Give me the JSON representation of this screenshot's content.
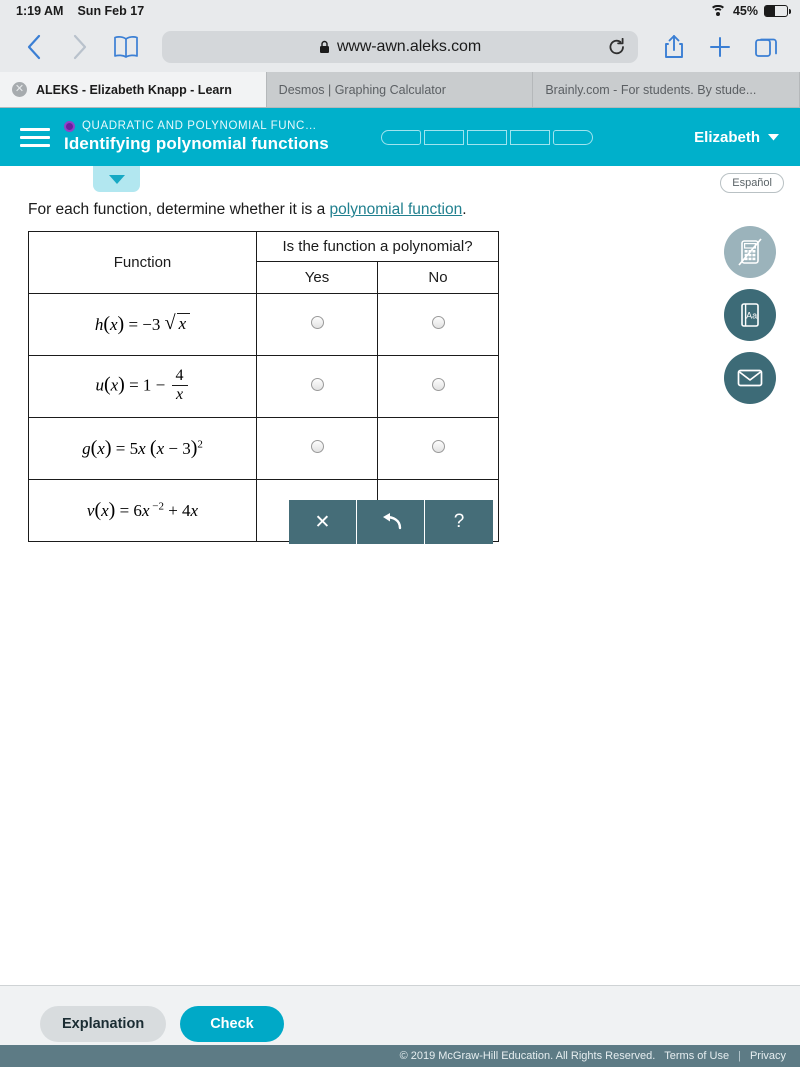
{
  "status_bar": {
    "time": "1:19 AM",
    "date": "Sun Feb 17",
    "battery_percent": "45%",
    "wifi_icon": "wifi-icon",
    "battery_icon": "battery-icon"
  },
  "browser": {
    "back_icon": "chevron-left-icon",
    "forward_icon": "chevron-right-icon",
    "bookmarks_icon": "book-icon",
    "lock_icon": "lock-icon",
    "url": "www-awn.aleks.com",
    "reload_icon": "reload-icon",
    "share_icon": "share-icon",
    "new_tab_icon": "plus-icon",
    "tabs_icon": "tabs-icon",
    "tabs": [
      {
        "label": "ALEKS - Elizabeth Knapp - Learn",
        "active": true,
        "close_icon": "close-icon"
      },
      {
        "label": "Desmos | Graphing Calculator",
        "active": false
      },
      {
        "label": "Brainly.com - For students. By stude...",
        "active": false
      }
    ]
  },
  "app_header": {
    "menu_icon": "hamburger-menu-icon",
    "topic_icon": "purple-circle-icon",
    "topic": "QUADRATIC AND POLYNOMIAL FUNC…",
    "title": "Identifying polynomial functions",
    "progress_segments": 5,
    "user_name": "Elizabeth",
    "user_caret_icon": "chevron-down-icon",
    "background_color": "#00b0cb"
  },
  "content": {
    "dropdown_tab_icon": "triangle-down-icon",
    "language_button": "Español",
    "instruction_pre": "For each function, determine whether it is a ",
    "instruction_link": "polynomial function",
    "instruction_post": ".",
    "link_color": "#21808f"
  },
  "table": {
    "col_function": "Function",
    "col_question": "Is the function a polynomial?",
    "col_yes": "Yes",
    "col_no": "No",
    "rows": [
      {
        "function_text": "h(x) = −3√x",
        "yes_selected": false,
        "no_selected": false
      },
      {
        "function_text": "u(x) = 1 − 4/x",
        "yes_selected": false,
        "no_selected": false
      },
      {
        "function_text": "g(x) = 5x(x − 3)²",
        "yes_selected": false,
        "no_selected": false
      },
      {
        "function_text": "v(x) = 6x⁻² + 4x",
        "yes_selected": false,
        "no_selected": false
      }
    ]
  },
  "answer_tools": [
    {
      "name": "clear-button",
      "glyph": "✕"
    },
    {
      "name": "undo-button",
      "glyph": "↶"
    },
    {
      "name": "help-button",
      "glyph": "?"
    }
  ],
  "side_tools": [
    {
      "name": "calculator-disabled-button",
      "icon": "calculator-disabled-icon",
      "disabled": true
    },
    {
      "name": "dictionary-button",
      "icon": "dictionary-book-icon",
      "label": "Aa",
      "disabled": false
    },
    {
      "name": "message-button",
      "icon": "envelope-icon",
      "disabled": false
    }
  ],
  "bottom_bar": {
    "explanation_label": "Explanation",
    "check_label": "Check",
    "check_color": "#00a9c7"
  },
  "footer": {
    "copyright": "© 2019 McGraw-Hill Education. All Rights Reserved.",
    "terms": "Terms of Use",
    "separator": "|",
    "privacy": "Privacy"
  }
}
